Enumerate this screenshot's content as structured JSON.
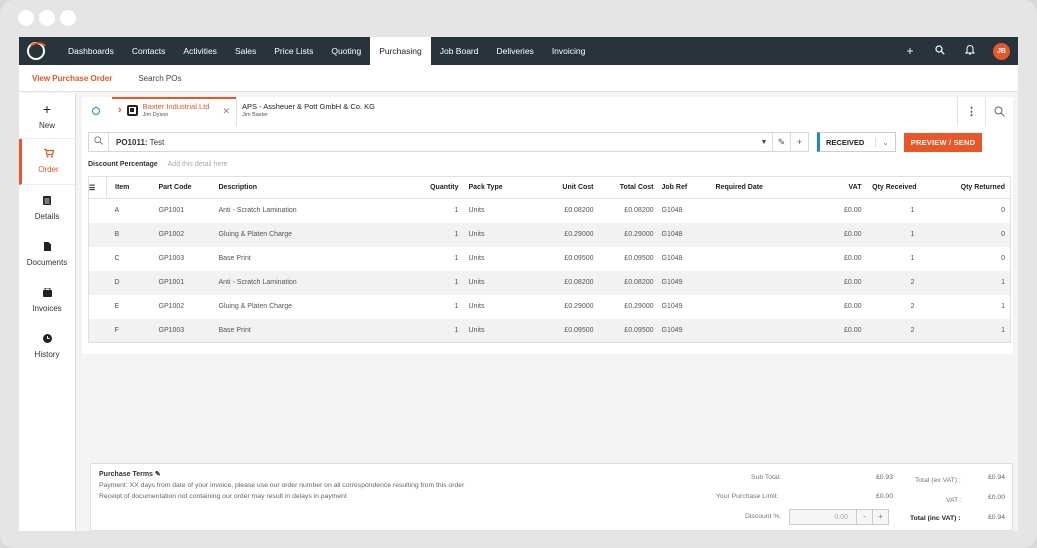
{
  "nav": {
    "items": [
      "Dashboards",
      "Contacts",
      "Activities",
      "Sales",
      "Price Lists",
      "Quoting",
      "Purchasing",
      "Job Board",
      "Deliveries",
      "Invoicing"
    ],
    "active": "Purchasing",
    "avatar_initials": "JB",
    "icons": [
      "plus-icon",
      "search-icon",
      "bell-icon"
    ]
  },
  "subnav": {
    "view_po": "View Purchase Order",
    "search_pos": "Search POs"
  },
  "sidebar": {
    "items": [
      {
        "label": "New",
        "icon": "plus-icon"
      },
      {
        "label": "Order",
        "icon": "cart-icon"
      },
      {
        "label": "Details",
        "icon": "list-icon"
      },
      {
        "label": "Documents",
        "icon": "document-icon"
      },
      {
        "label": "Invoices",
        "icon": "invoice-icon"
      },
      {
        "label": "History",
        "icon": "clock-icon"
      }
    ]
  },
  "tabs": [
    {
      "title": "Baxter Industrial Ltd",
      "subtitle": "Jim Dyson"
    },
    {
      "title": "APS - Assheuer & Pott GmbH & Co. KG",
      "subtitle": "Jim Baxter"
    }
  ],
  "po": {
    "number": "PO1011:",
    "name": "Test",
    "status": "RECEIVED",
    "preview_label": "PREVIEW / SEND"
  },
  "discount": {
    "label": "Discount Percentage",
    "placeholder": "Add this detail here"
  },
  "table": {
    "headers": [
      "Item",
      "Part Code",
      "Description",
      "Quantity",
      "Pack Type",
      "Unit Cost",
      "Total Cost",
      "Job Ref",
      "Required Date",
      "VAT",
      "Qty Received",
      "Qty Returned"
    ],
    "rows": [
      [
        "A",
        "GP1001",
        "Anti - Scratch Lamination",
        "1",
        "Units",
        "£0.08200",
        "£0.08200",
        "G1048",
        "",
        "£0.00",
        "1",
        "0"
      ],
      [
        "B",
        "GP1002",
        "Gluing & Platen Charge",
        "1",
        "Units",
        "£0.29000",
        "£0.29000",
        "G1048",
        "",
        "£0.00",
        "1",
        "0"
      ],
      [
        "C",
        "GP1003",
        "Base Print",
        "1",
        "Units",
        "£0.09500",
        "£0.09500",
        "G1048",
        "",
        "£0.00",
        "1",
        "0"
      ],
      [
        "D",
        "GP1001",
        "Anti - Scratch Lamination",
        "1",
        "Units",
        "£0.08200",
        "£0.08200",
        "G1049",
        "",
        "£0.00",
        "2",
        "1"
      ],
      [
        "E",
        "GP1002",
        "Gluing & Platen Charge",
        "1",
        "Units",
        "£0.29000",
        "£0.29000",
        "G1049",
        "",
        "£0.00",
        "2",
        "1"
      ],
      [
        "F",
        "GP1003",
        "Base Print",
        "1",
        "Units",
        "£0.09500",
        "£0.09500",
        "G1049",
        "",
        "£0.00",
        "2",
        "1"
      ]
    ]
  },
  "footer": {
    "terms_title": "Purchase Terms",
    "terms_line1": "Payment: XX days from date of your invoice, please use our order number on all correspondence resulting from this order",
    "terms_line2": "Receipt of documentation not containing our order may result in delays in payment",
    "sub_total_label": "Sub Total:",
    "sub_total": "£0.93",
    "purchase_limit_label": "Your Purchase Limit:",
    "purchase_limit": "£0.00",
    "discount_label": "Discount %:",
    "discount_value": "0.00",
    "total_ex_vat_label": "Total (ex VAT) :",
    "total_ex_vat": "£0.94",
    "vat_label": "VAT :",
    "vat": "£0.00",
    "total_inc_vat_label": "Total (inc VAT) :",
    "total_inc_vat": "£0.94"
  }
}
